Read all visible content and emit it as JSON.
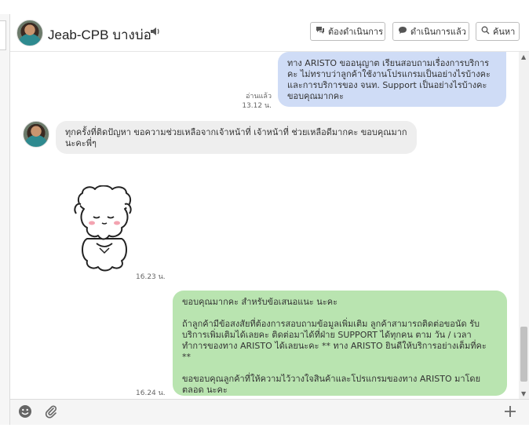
{
  "header": {
    "contact_name": "Jeab-CPB บางบ่อ",
    "sound_icon": "speaker-icon",
    "buttons": {
      "todo": "ต้องดำเนินการ",
      "done": "ดำเนินการแล้ว",
      "search": "ค้นหา"
    }
  },
  "messages": {
    "out1": {
      "text": "ทาง ARISTO ขออนุญาต เรียนสอบถามเรื่องการบริการ คะ ไม่ทราบว่าลูกค้าใช้งานโปรแกรมเป็นอย่างไรบ้างคะ และการบริการของ จนท. Support เป็นอย่างไรบ้างคะ ขอบคุณมากคะ",
      "read_label": "อ่านแล้ว",
      "time": "13.12 น."
    },
    "in1": {
      "text": "ทุกครั้งที่ติดปัญหา ขอความช่วยเหลือจากเจ้าหน้าที่ เจ้าหน้าที่ ช่วยเหลือดีมากคะ ขอบคุณมากนะคะพี่ๆ"
    },
    "sticker": {
      "time": "16.23 น."
    },
    "out2": {
      "line1": "ขอบคุณมากคะ สำหรับข้อเสนอแนะ นะคะ",
      "line2": "ถ้าลูกค้ามีข้อสงสัยที่ต้องการสอบถามข้อมูลเพิ่มเติม ลูกค้าสามารถติดต่อขอนัด รับบริการเพิ่มเติมได้เลยคะ ติดต่อมาได้ที่ฝ่าย SUPPORT ได้ทุกคน ตาม วัน / เวลา ทำการของทาง ARISTO ได้เลยนะคะ ** ทาง ARISTO ยินดีให้บริการอย่างเต็มที่คะ **",
      "line3": "ขอขอบคุณลูกค้าที่ให้ความไว้วางใจสินค้าและโปรแกรมของทาง ARISTO มาโดยตลอด นะคะ",
      "time": "16.24 น."
    }
  },
  "footer": {
    "emoji_icon": "emoji-icon",
    "attach_icon": "paperclip-icon",
    "add_icon": "plus-icon"
  },
  "colors": {
    "outgoing_blue": "#cfdcf6",
    "incoming_gray": "#eeeeee",
    "outgoing_green": "#b9e4b0"
  }
}
